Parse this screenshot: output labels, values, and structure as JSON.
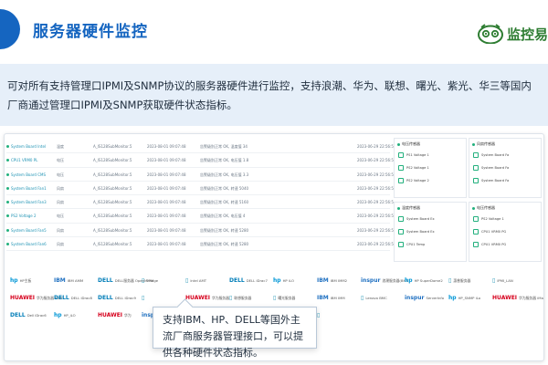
{
  "header": {
    "title": "服务器硬件监控",
    "brand_text": "监控易"
  },
  "intro": {
    "text": "可对所有支持管理口IPMI及SNMP协议的服务器硬件进行监控，支持浪潮、华为、联想、曙光、紫光、华三等国内厂商通过管理口IPMI及SNMP获取硬件状态指标。"
  },
  "table": {
    "rows": [
      {
        "name": "System Board Intel",
        "type": "温度",
        "source": "A_IS128SubMonitor.5",
        "time1": "2023-08-01 09:07:48",
        "desc": "告警级别正常 OK, 温度值 34",
        "time2": "2023-06-29 22:56:54"
      },
      {
        "name": "CPU1 VRM0 PL",
        "type": "电压",
        "source": "A_IS128SubMonitor.5",
        "time1": "2023-08-01 09:07:48",
        "desc": "告警级别正常 OK, 电压值 1.8",
        "time2": "2023-06-29 22:56:54"
      },
      {
        "name": "System Board CMS",
        "type": "电压",
        "source": "A_IS128SubMonitor.5",
        "time1": "2023-08-01 09:07:48",
        "desc": "告警级别正常 OK, 电压值 3.3",
        "time2": "2023-06-29 22:56:54"
      },
      {
        "name": "System Board Fan1",
        "type": "风扇",
        "source": "A_IS128SubMonitor.5",
        "time1": "2023-08-01 09:07:48",
        "desc": "告警级别正常 OK, 转速 5040",
        "time2": "2023-06-29 22:56:54"
      },
      {
        "name": "System Board Fan3",
        "type": "风扇",
        "source": "A_IS128SubMonitor.5",
        "time1": "2023-08-01 09:07:48",
        "desc": "告警级别正常 OK, 转速 5160",
        "time2": "2023-06-29 22:56:54"
      },
      {
        "name": "PS2 Voltage 2",
        "type": "电压",
        "source": "A_IS128SubMonitor.5",
        "time1": "2023-08-01 09:07:48",
        "desc": "告警级别正常 OK, 电压值 4",
        "time2": "2023-06-29 22:56:54"
      },
      {
        "name": "System Board Fan5",
        "type": "风扇",
        "source": "A_IS128SubMonitor.5",
        "time1": "2023-08-01 09:07:48",
        "desc": "告警级别正常 OK, 转速 5280",
        "time2": "2023-06-29 22:56:54"
      },
      {
        "name": "System Board Fan6",
        "type": "风扇",
        "source": "A_IS128SubMonitor.5",
        "time1": "2023-08-01 09:07:48",
        "desc": "告警级别正常 OK, 转速 5280",
        "time2": "2023-06-29 22:56:54"
      }
    ]
  },
  "panels": [
    {
      "title": "电压传感器",
      "items": [
        "PS1 Voltage 1",
        "PS2 Voltage 1",
        "PS2 Voltage 2"
      ]
    },
    {
      "title": "风扇传感器",
      "items": [
        "System Board Fa",
        "System Board Fa",
        "System Board Fa"
      ]
    },
    {
      "title": "温度传感器",
      "items": [
        "System Board Ex",
        "System Board Ex",
        "CPU1 Temp"
      ]
    },
    {
      "title": "电压传感器",
      "items": [
        "PS2 Voltage 1",
        "CPU1 VRM0 PG",
        "CPU1 VRM0 PG"
      ]
    }
  ],
  "logos": [
    [
      {
        "mark": "hp",
        "label": "HP主板",
        "color": "#0096d6"
      },
      {
        "mark": "IBM",
        "label": "IBM AMM",
        "color": "#1f70c1"
      },
      {
        "mark": "DELL",
        "label": "DELL服务器 OpenManage",
        "color": "#007db8"
      },
      {
        "mark": "▯",
        "label": "TPM",
        "color": "#1f93b4"
      },
      {
        "mark": "▯",
        "label": "Intel AMT",
        "color": "#1f93b4"
      },
      {
        "mark": "DELL",
        "label": "DELL iDrac7",
        "color": "#007db8"
      },
      {
        "mark": "hp",
        "label": "HP iLO",
        "color": "#0096d6"
      },
      {
        "mark": "IBM",
        "label": "IBM IMM2",
        "color": "#1f70c1"
      },
      {
        "mark": "inspur",
        "label": "浪潮服务器(BMC)",
        "color": "#1f70c1"
      },
      {
        "mark": "hp",
        "label": "HP SuperDome2",
        "color": "#0096d6"
      },
      {
        "mark": "▯",
        "label": "惠普服务器",
        "color": "#1f93b4"
      },
      {
        "mark": "▯",
        "label": "IPMI_LAN",
        "color": "#1f93b4"
      }
    ],
    [
      {
        "mark": "HUAWEI",
        "label": "华为服务器 iBMC",
        "color": "#d6001c"
      },
      {
        "mark": "DELL",
        "label": "DELL iDrac8",
        "color": "#007db8"
      },
      {
        "mark": "DELL",
        "label": "DELL iDrac9",
        "color": "#007db8"
      },
      {
        "mark": "▯",
        "label": "",
        "color": "#1f93b4"
      },
      {
        "mark": "HUAWEI",
        "label": "华为服务器",
        "color": "#d6001c"
      },
      {
        "mark": "▯",
        "label": "联想服务器",
        "color": "#1f93b4"
      },
      {
        "mark": "▯",
        "label": "曙光服务器",
        "color": "#1f93b4"
      },
      {
        "mark": "IBM",
        "label": "IBM IMM",
        "color": "#1f70c1"
      },
      {
        "mark": "▯",
        "label": "Lenovo BMC",
        "color": "#1f93b4"
      },
      {
        "mark": "inspur",
        "label": "ServerInfo",
        "color": "#1f70c1"
      },
      {
        "mark": "hp",
        "label": "HP_SNMP iLo",
        "color": "#0096d6"
      },
      {
        "mark": "HUAWEI",
        "label": "华为服务器 iMana",
        "color": "#d6001c"
      }
    ],
    [
      {
        "mark": "DELL",
        "label": "Dell iDrac6",
        "color": "#007db8"
      },
      {
        "mark": "hp",
        "label": "HP_iLO",
        "color": "#0096d6"
      },
      {
        "mark": "HUAWEI",
        "label": "华为",
        "color": "#d6001c"
      },
      {
        "mark": "inspur",
        "label": "",
        "color": "#1f70c1"
      },
      {
        "mark": "▯",
        "label": "",
        "color": "#1f93b4"
      },
      {
        "mark": "▯",
        "label": "Generic SuMiCro",
        "color": "#1f93b4"
      },
      {
        "mark": "IBM",
        "label": "Plus_System",
        "color": "#1f70c1"
      },
      {
        "mark": "▯",
        "label": "",
        "color": "#1f93b4"
      }
    ]
  ],
  "tooltip": {
    "text": "支持IBM、HP、DELL等国外主流厂商服务器管理接口，可以提供各种硬件状态指标。"
  },
  "colors": {
    "accent": "#1565c0",
    "intro_bg": "#e6eff9",
    "brand": "#2e7d32",
    "ok_green": "#22b07d"
  }
}
